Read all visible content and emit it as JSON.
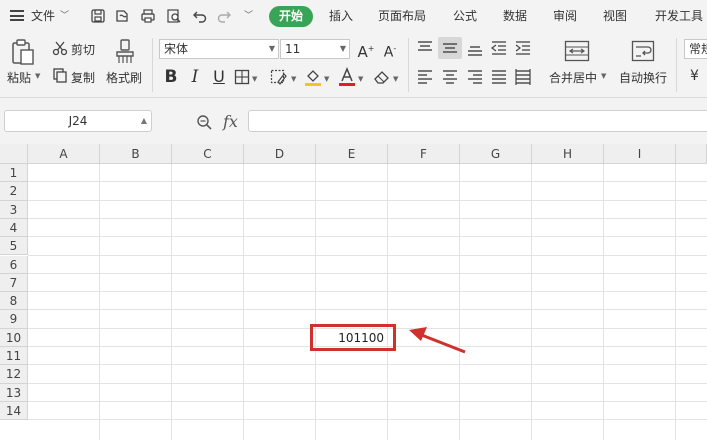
{
  "menubar": {
    "file_label": "文件",
    "tabs": [
      {
        "label": "开始",
        "active": true
      },
      {
        "label": "插入"
      },
      {
        "label": "页面布局"
      },
      {
        "label": "公式"
      },
      {
        "label": "数据"
      },
      {
        "label": "审阅"
      },
      {
        "label": "视图"
      },
      {
        "label": "开发工具"
      }
    ]
  },
  "ribbon": {
    "paste_label": "粘贴",
    "cut_label": "剪切",
    "copy_label": "复制",
    "format_painter_label": "格式刷",
    "font_name": "宋体",
    "font_size": "11",
    "merge_center_label": "合并居中",
    "wrap_text_label": "自动换行",
    "number_format_label": "常规",
    "currency_symbol": "¥"
  },
  "formula_bar": {
    "cell_ref": "J24",
    "fx_label": "fx",
    "formula_value": ""
  },
  "sheet": {
    "columns": [
      "A",
      "B",
      "C",
      "D",
      "E",
      "F",
      "G",
      "H",
      "I"
    ],
    "rows": [
      "1",
      "2",
      "3",
      "4",
      "5",
      "6",
      "7",
      "8",
      "9",
      "10",
      "11",
      "12",
      "13",
      "14"
    ],
    "cell_E10": "101100"
  },
  "colors": {
    "accent_green": "#3aa456",
    "highlight_red": "#d0312d",
    "font_color_red": "#e02020",
    "fill_yellow": "#f5c518"
  }
}
